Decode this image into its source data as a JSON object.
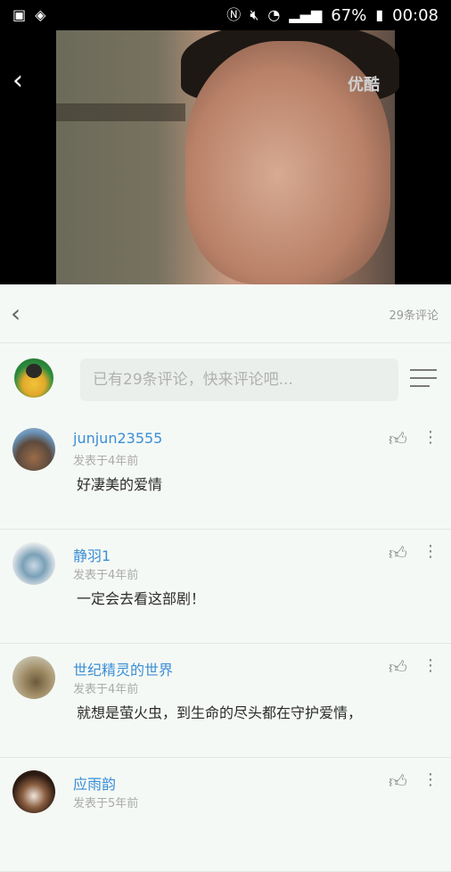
{
  "status_bar": {
    "battery_percent": "67%",
    "time": "00:08"
  },
  "video": {
    "watermark": "优酷"
  },
  "toolbar": {
    "comment_count": "29条评论"
  },
  "compose": {
    "placeholder": "已有29条评论，快来评论吧..."
  },
  "comments": [
    {
      "name": "junjun23555",
      "time": "发表于4年前",
      "text": "好凄美的爱情"
    },
    {
      "name": "静羽1",
      "time": "发表于4年前",
      "text": "一定会去看这部剧！"
    },
    {
      "name": "世纪精灵的世界",
      "time": "发表于4年前",
      "text": "就想是萤火虫，到生命的尽头都在守护爱情，"
    },
    {
      "name": "应雨韵",
      "time": "发表于5年前",
      "text": ""
    }
  ]
}
